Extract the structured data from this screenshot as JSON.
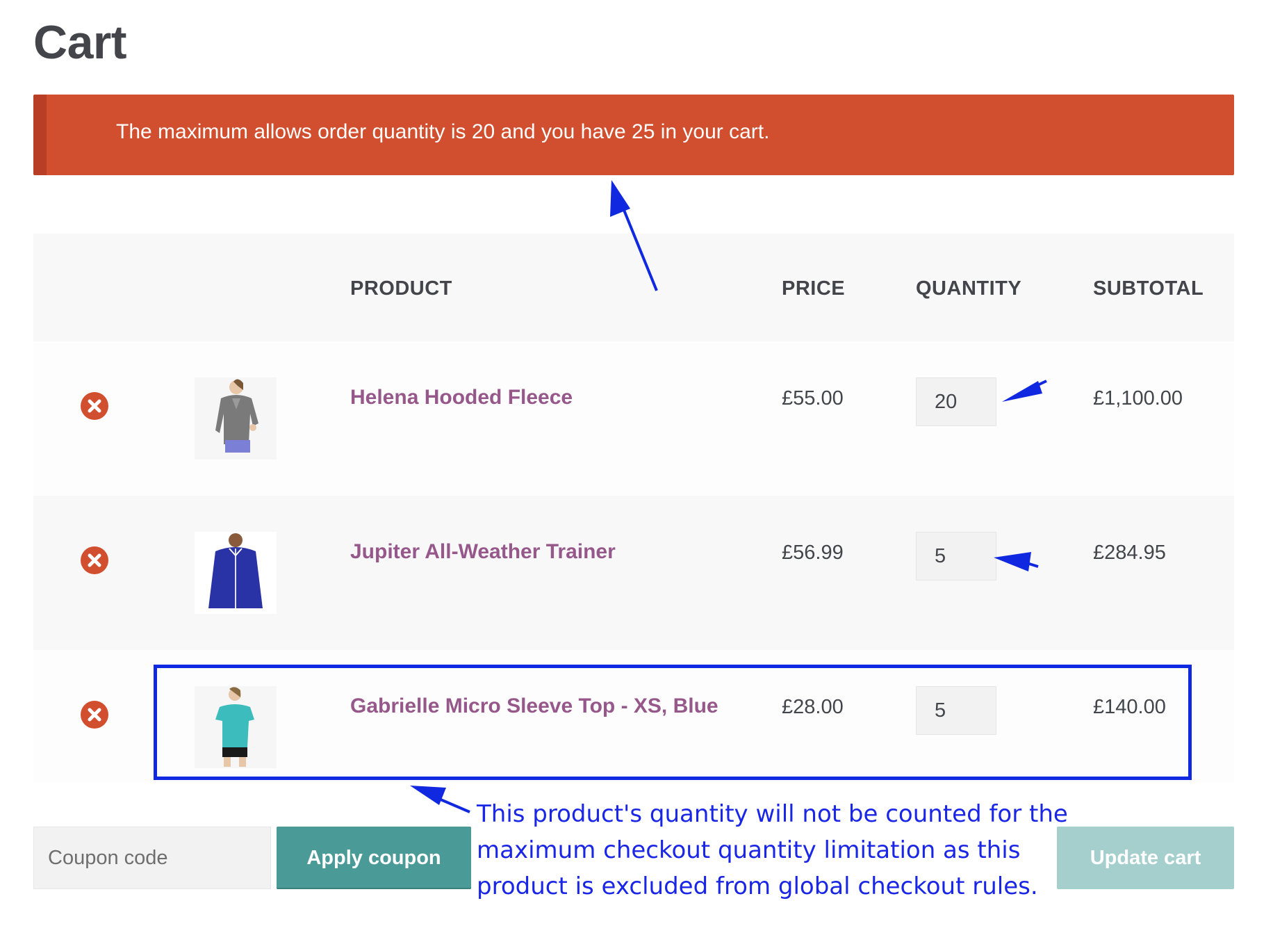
{
  "page": {
    "title": "Cart"
  },
  "notice": {
    "message": "The maximum allows order quantity is 20 and you have 25 in your cart."
  },
  "table": {
    "headers": {
      "product": "PRODUCT",
      "price": "PRICE",
      "quantity": "QUANTITY",
      "subtotal": "SUBTOTAL"
    },
    "rows": [
      {
        "name": "Helena Hooded Fleece",
        "price": "£55.00",
        "quantity": "20",
        "subtotal": "£1,100.00",
        "image": "woman-grey-hoodie-image"
      },
      {
        "name": "Jupiter All-Weather Trainer",
        "price": "£56.99",
        "quantity": "5",
        "subtotal": "£284.95",
        "image": "man-blue-jacket-image"
      },
      {
        "name": "Gabrielle Micro Sleeve Top - XS, Blue",
        "price": "£28.00",
        "quantity": "5",
        "subtotal": "£140.00",
        "image": "woman-teal-top-image"
      }
    ]
  },
  "actions": {
    "coupon_placeholder": "Coupon code",
    "apply_coupon": "Apply coupon",
    "update_cart": "Update cart"
  },
  "annotation": {
    "lines": [
      "This product's quantity will not be counted for the",
      "maximum checkout quantity limitation as this",
      "product is excluded from global checkout rules."
    ]
  },
  "colors": {
    "notice_bg": "#d14e2e",
    "product_link": "#96588a",
    "primary_button": "#4a9a98",
    "disabled_button": "#a4cfcd",
    "annotation_blue": "#1a26e6",
    "remove_icon": "#d14e2e"
  }
}
